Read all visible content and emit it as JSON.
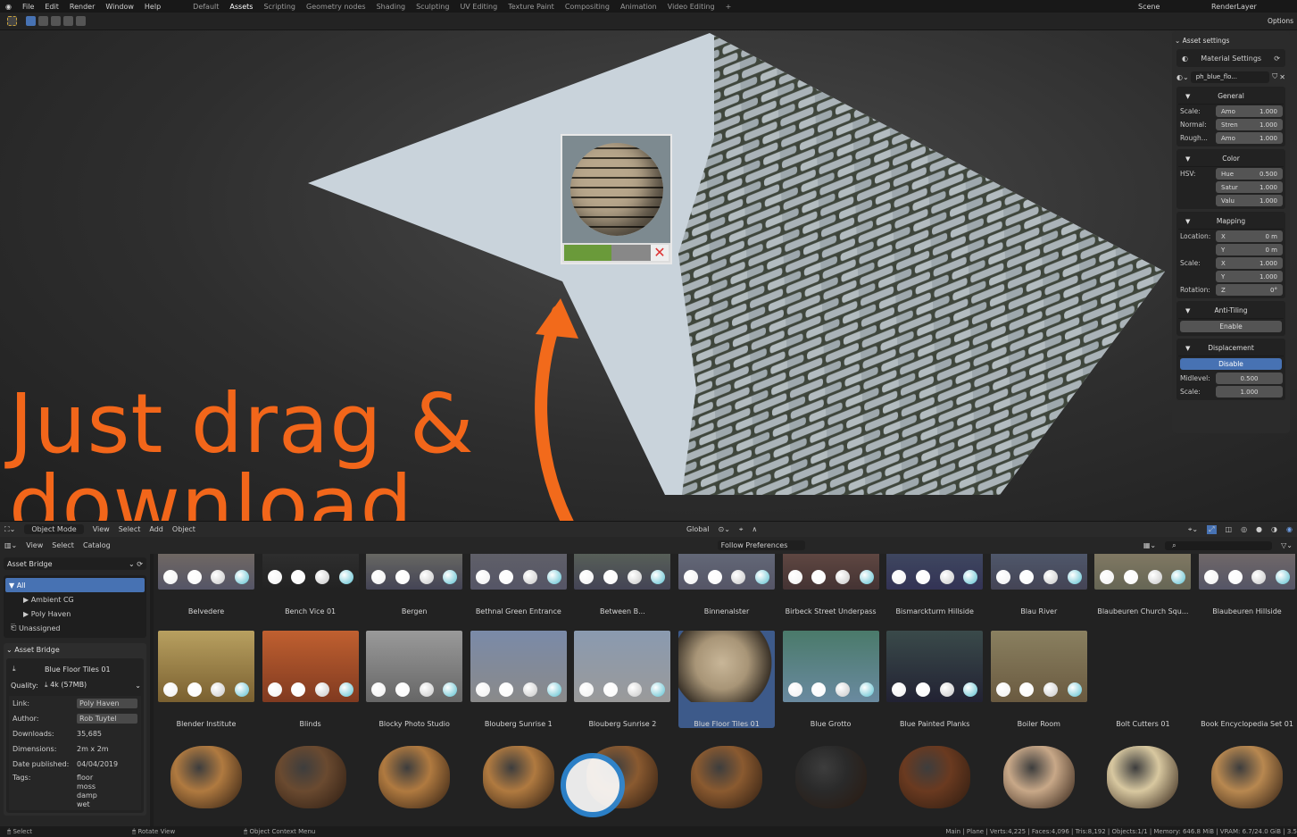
{
  "menu": {
    "items": [
      "File",
      "Edit",
      "Render",
      "Window",
      "Help"
    ]
  },
  "workspaces": {
    "tabs": [
      "Default",
      "Assets",
      "Scripting",
      "Geometry nodes",
      "Shading",
      "Sculpting",
      "UV Editing",
      "Texture Paint",
      "Compositing",
      "Animation",
      "Video Editing"
    ],
    "active": "Assets",
    "add": "+"
  },
  "scene": {
    "scene_name": "Scene",
    "view_layer": "RenderLayer",
    "options": "Options"
  },
  "overlay_text": {
    "line1": "Just drag &",
    "line2": "download"
  },
  "drag_preview": {
    "progress": 0.55,
    "colors": {
      "progress": "#6a9a3a",
      "cancel": "#d33333"
    }
  },
  "asset_settings": {
    "title": "Asset settings",
    "material_settings": "Material Settings",
    "material_name": "ph_blue_flo...",
    "general": {
      "title": "General",
      "rows": [
        {
          "label": "Scale:",
          "field": "Amo",
          "value": "1.000"
        },
        {
          "label": "Normal:",
          "field": "Stren",
          "value": "1.000"
        },
        {
          "label": "Rough...",
          "field": "Amo",
          "value": "1.000"
        }
      ]
    },
    "color": {
      "title": "Color",
      "label": "HSV:",
      "rows": [
        {
          "field": "Hue",
          "value": "0.500"
        },
        {
          "field": "Satur",
          "value": "1.000"
        },
        {
          "field": "Valu",
          "value": "1.000"
        }
      ]
    },
    "mapping": {
      "title": "Mapping",
      "location_label": "Location:",
      "scale_label": "Scale:",
      "rotation_label": "Rotation:",
      "location": [
        {
          "axis": "X",
          "value": "0 m"
        },
        {
          "axis": "Y",
          "value": "0 m"
        }
      ],
      "scale": [
        {
          "axis": "X",
          "value": "1.000"
        },
        {
          "axis": "Y",
          "value": "1.000"
        }
      ],
      "rotation": {
        "axis": "Z",
        "value": "0°"
      }
    },
    "anti_tiling": {
      "title": "Anti-Tiling",
      "button": "Enable"
    },
    "displacement": {
      "title": "Displacement",
      "button": "Disable",
      "midlevel_label": "Midlevel:",
      "midlevel": "0.500",
      "scale_label": "Scale:",
      "scale": "1.000"
    }
  },
  "viewport_header": {
    "mode": "Object Mode",
    "menus": [
      "View",
      "Select",
      "Add",
      "Object"
    ],
    "orientation": "Global"
  },
  "asset_browser_header": {
    "menus": [
      "View",
      "Select",
      "Catalog"
    ],
    "import_method": "Follow Preferences"
  },
  "sidebar": {
    "library": "Asset Bridge",
    "catalogs": [
      {
        "label": "All",
        "selected": true
      },
      {
        "label": "Ambient CG"
      },
      {
        "label": "Poly Haven"
      },
      {
        "label": "Unassigned"
      }
    ],
    "panel_title": "Asset Bridge",
    "asset_name": "Blue Floor Tiles 01",
    "quality_label": "Quality:",
    "quality": "4k (57MB)",
    "info": [
      {
        "key": "Link:",
        "value": "Poly Haven",
        "boxed": true
      },
      {
        "key": "Author:",
        "value": "Rob Tuytel",
        "boxed": true
      },
      {
        "key": "Downloads:",
        "value": "35,685"
      },
      {
        "key": "Dimensions:",
        "value": "2m x 2m"
      },
      {
        "key": "Date published:",
        "value": "04/04/2019"
      }
    ],
    "tags_label": "Tags:",
    "tags": [
      "floor",
      "moss",
      "damp",
      "wet"
    ]
  },
  "assets": {
    "row1": [
      "Belvedere",
      "Bench Vice 01",
      "Bergen",
      "Bethnal Green Entrance",
      "Between B...",
      "Binnenalster",
      "Birbeck Street Underpass",
      "Bismarckturm Hillside",
      "Blau River",
      "Blaubeuren Church Squ...",
      "Blaubeuren Hillside"
    ],
    "row2": [
      "Blender Institute",
      "Blinds",
      "Blocky Photo Studio",
      "Blouberg Sunrise 1",
      "Blouberg Sunrise 2",
      "Blue Floor Tiles 01",
      "Blue Grotto",
      "Blue Painted Planks",
      "Boiler Room",
      "Bolt Cutters 01",
      "Book Encyclopedia Set 01"
    ],
    "selected": "Blue Floor Tiles 01"
  },
  "status_bar": {
    "select": "Select",
    "rotate": "Rotate View",
    "context": "Object Context Menu",
    "stats": "Main | Plane | Verts:4,225 | Faces:4,096 | Tris:8,192 | Objects:1/1 | Memory: 646.8 MiB | VRAM: 6.7/24.0 GiB | 3.5"
  },
  "colors": {
    "accent": "#4772b3",
    "overlay_orange": "#f2661a"
  }
}
